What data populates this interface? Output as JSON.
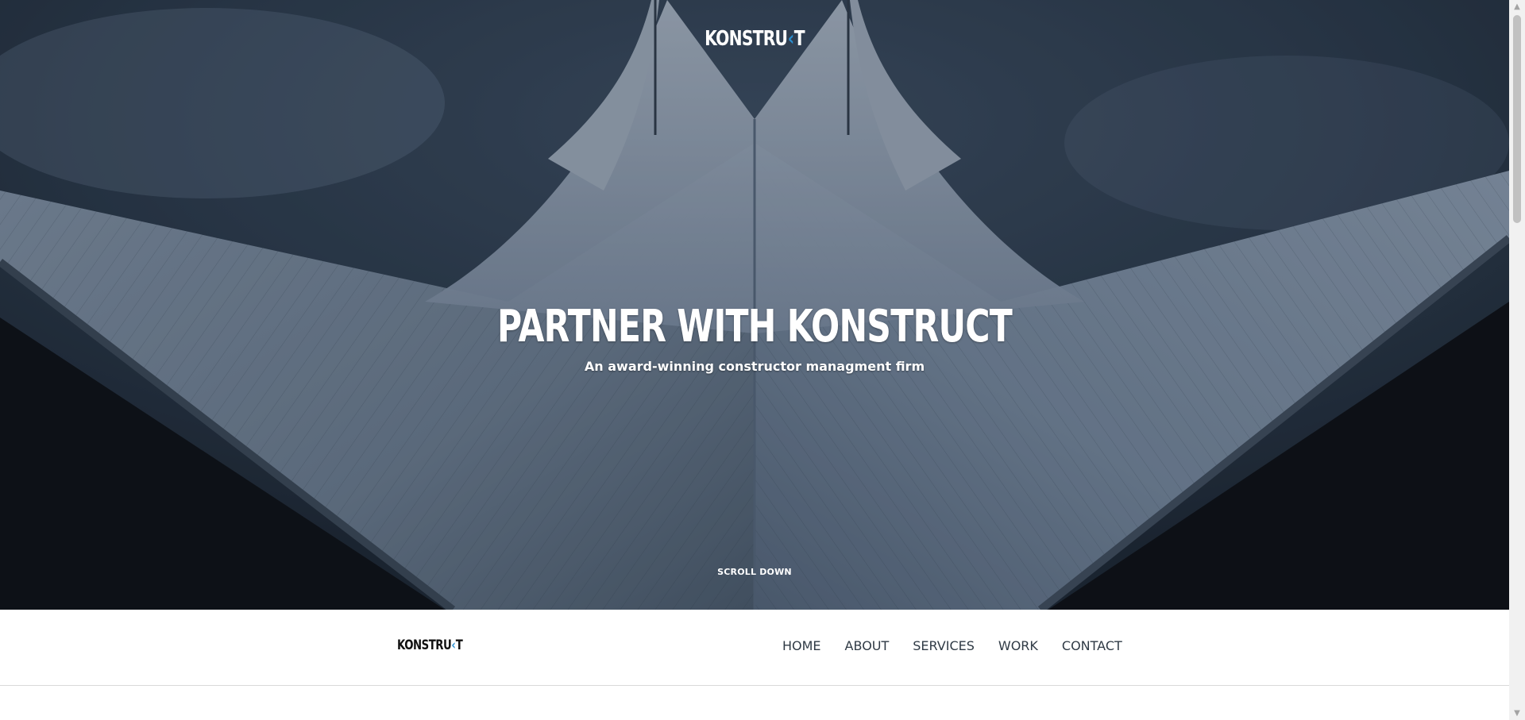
{
  "hero": {
    "logo": {
      "before": "KONSTRU",
      "accent": "‹",
      "after": "T"
    },
    "title": "PARTNER WITH KONSTRUCT",
    "subtitle": "An award-winning constructor managment firm",
    "scroll_label": "SCROLL DOWN"
  },
  "navbar": {
    "logo": {
      "before": "KONSTRU",
      "accent": "‹",
      "after": "T"
    },
    "links": [
      "HOME",
      "ABOUT",
      "SERVICES",
      "WORK",
      "CONTACT"
    ]
  },
  "colors": {
    "accent": "#2a8fd1",
    "nav_text": "#2f3a45",
    "hero_sky": "#2b3a4b"
  },
  "icons": {
    "scroll_up": "scroll-up-arrow-icon",
    "scroll_down": "scroll-down-arrow-icon"
  }
}
